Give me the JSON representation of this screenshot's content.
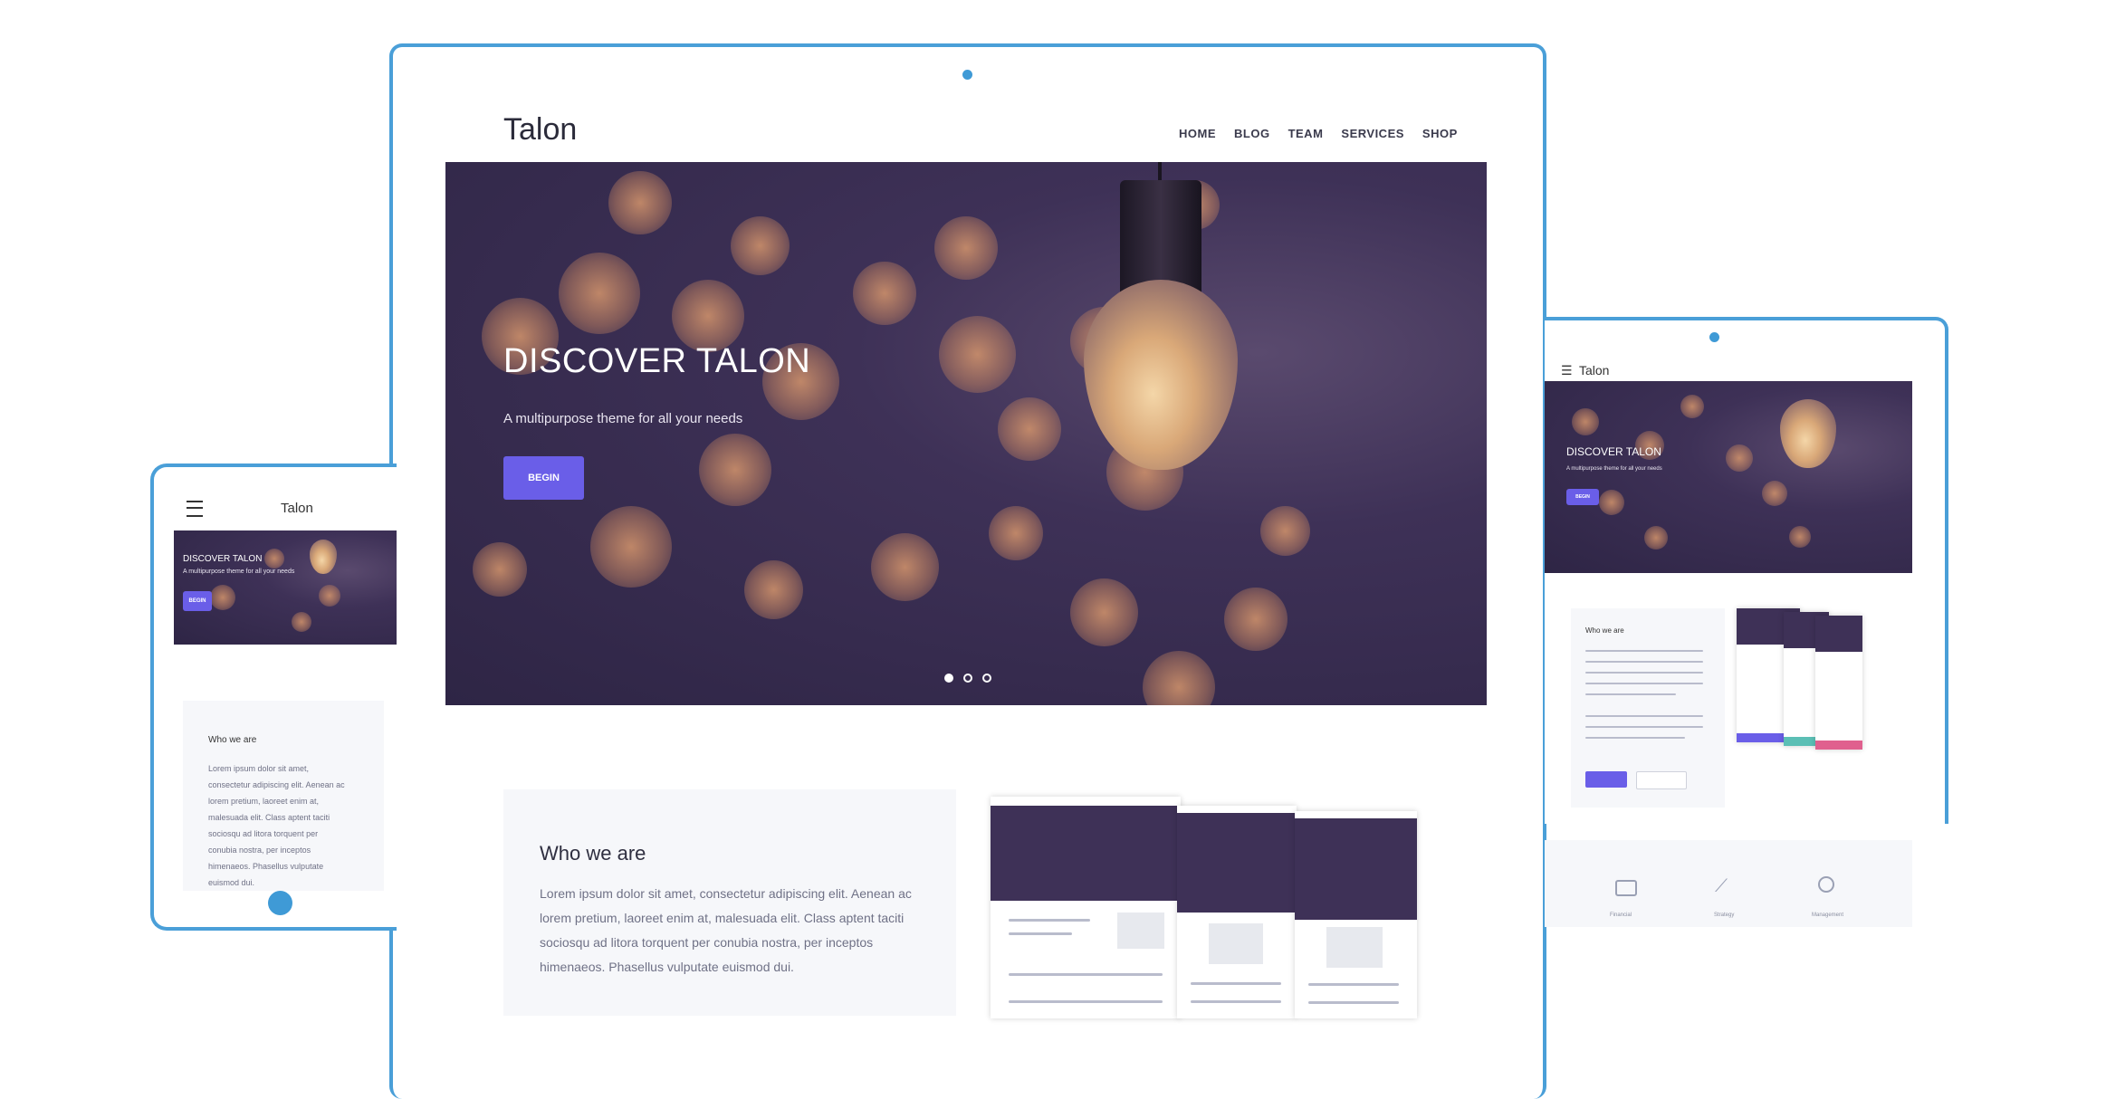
{
  "brand": "Talon",
  "nav": [
    "HOME",
    "BLOG",
    "TEAM",
    "SERVICES",
    "SHOP"
  ],
  "hero": {
    "title": "DISCOVER TALON",
    "subtitle": "A multipurpose theme for all your needs",
    "button": "BEGIN",
    "slides": 3,
    "active_slide": 0
  },
  "about": {
    "heading": "Who we are",
    "body": "Lorem ipsum dolor sit amet, consectetur adipiscing elit. Aenean ac lorem pretium, laoreet enim at, malesuada elit. Class aptent taciti sociosqu ad litora torquent per conubia nostra, per inceptos himenaeos. Phasellus vulputate euismod dui."
  },
  "phone": {
    "brand": "Talon",
    "hero_title": "DISCOVER TALON",
    "hero_subtitle": "A multipurpose theme for all your needs",
    "button": "BEGIN",
    "about_heading": "Who we are",
    "about_lines": [
      "Lorem ipsum dolor sit amet,",
      "consectetur adipiscing elit. Aenean ac",
      "lorem pretium, laoreet enim at,",
      "malesuada elit. Class aptent taciti",
      "sociosqu ad litora torquent per",
      "conubia nostra, per inceptos",
      "himenaeos. Phasellus vulputate",
      "euismod dui."
    ]
  },
  "tablet": {
    "brand": "Talon",
    "hero_title": "DISCOVER TALON",
    "hero_subtitle": "A multipurpose theme for all your needs",
    "button": "BEGIN",
    "about_heading": "Who we are",
    "features": [
      "Financial",
      "Strategy",
      "Management"
    ]
  },
  "colors": {
    "frame": "#4a9fd8",
    "accent": "#6a5ee8",
    "hero": "#3e3157"
  }
}
